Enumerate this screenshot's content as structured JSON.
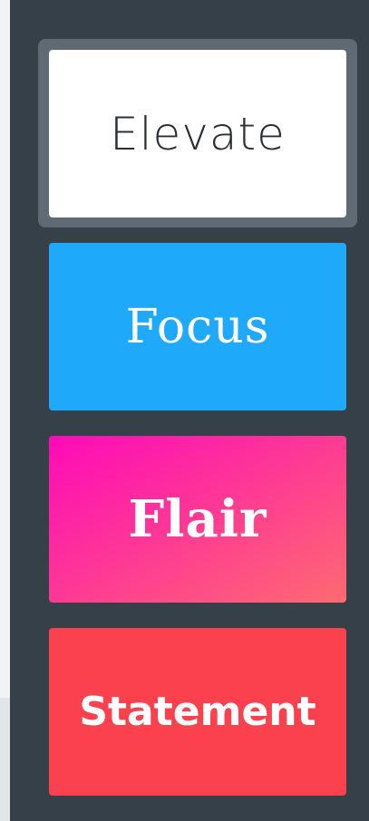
{
  "colors": {
    "panel_bg": "#364049",
    "selected_ring": "#5f6a74",
    "elevate_bg": "#ffffff",
    "elevate_text": "#2b2f33",
    "focus_bg": "#1ea9fb",
    "flair_gradient": [
      "#ff09b9",
      "#fd6a70"
    ],
    "statement_bg": "#fa414d",
    "card_text": "#ffffff"
  },
  "themes": [
    {
      "label": "Elevate",
      "selected": true
    },
    {
      "label": "Focus",
      "selected": false
    },
    {
      "label": "Flair",
      "selected": false
    },
    {
      "label": "Statement",
      "selected": false
    }
  ]
}
